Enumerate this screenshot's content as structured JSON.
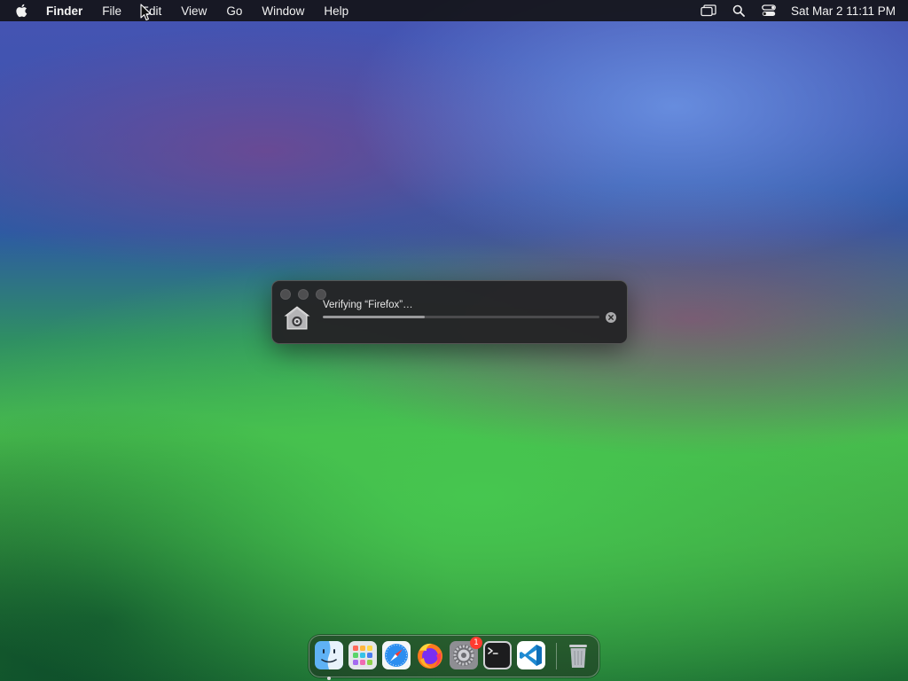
{
  "menubar": {
    "apple_icon": "apple-logo-icon",
    "app_name": "Finder",
    "menus": [
      "File",
      "Edit",
      "View",
      "Go",
      "Window",
      "Help"
    ],
    "status_icons": [
      "screen-mirroring-icon",
      "spotlight-search-icon",
      "control-center-icon"
    ],
    "clock": "Sat Mar 2  11:11 PM"
  },
  "dialog": {
    "title": "Verifying “Firefox”…",
    "icon": "security-verify-icon",
    "progress_fraction": 0.37,
    "cancel_icon": "close-icon"
  },
  "dock": {
    "apps": [
      {
        "name": "Finder",
        "icon": "finder-icon",
        "running": true
      },
      {
        "name": "Launchpad",
        "icon": "launchpad-icon",
        "running": false
      },
      {
        "name": "Safari",
        "icon": "safari-icon",
        "running": false
      },
      {
        "name": "Firefox",
        "icon": "firefox-icon",
        "running": false
      },
      {
        "name": "System Settings",
        "icon": "system-settings-icon",
        "running": false,
        "badge": "1"
      },
      {
        "name": "Terminal",
        "icon": "terminal-icon",
        "running": false
      },
      {
        "name": "Visual Studio Code",
        "icon": "vscode-icon",
        "running": false
      }
    ],
    "trash": {
      "name": "Trash",
      "icon": "trash-icon"
    }
  },
  "colors": {
    "menubar_bg": "#141418",
    "dialog_bg": "#242426",
    "badge": "#ff3b30",
    "vscode_blue": "#1f8ad2"
  }
}
